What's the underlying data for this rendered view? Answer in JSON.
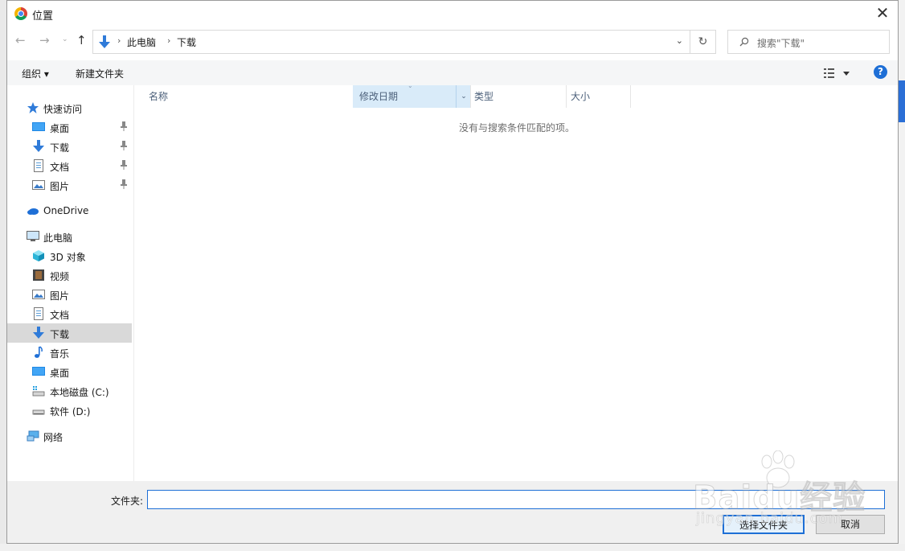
{
  "window": {
    "title": "位置",
    "close_glyph": "✕"
  },
  "navigation": {
    "back_glyph": "←",
    "forward_glyph": "→",
    "recent_glyph": "⌄",
    "up_glyph": "↑",
    "refresh_glyph": "↻",
    "breadcrumb_sep": "›",
    "dropdown_glyph": "⌄",
    "breadcrumbs": [
      "此电脑",
      "下载"
    ]
  },
  "search": {
    "placeholder": "搜索\"下载\""
  },
  "toolbar": {
    "organize_label": "组织 ▾",
    "new_folder_label": "新建文件夹",
    "help_glyph": "?"
  },
  "sidebar": {
    "items": [
      {
        "label": "快速访问",
        "icon": "star-icon"
      },
      {
        "label": "桌面",
        "icon": "desktop-icon",
        "pinned": true
      },
      {
        "label": "下载",
        "icon": "download-icon",
        "pinned": true
      },
      {
        "label": "文档",
        "icon": "document-icon",
        "pinned": true
      },
      {
        "label": "图片",
        "icon": "pictures-icon",
        "pinned": true
      },
      {
        "label": "OneDrive",
        "icon": "cloud-icon"
      },
      {
        "label": "此电脑",
        "icon": "computer-icon"
      },
      {
        "label": "3D 对象",
        "icon": "cube-icon"
      },
      {
        "label": "视频",
        "icon": "video-icon"
      },
      {
        "label": "图片",
        "icon": "pictures-icon"
      },
      {
        "label": "文档",
        "icon": "document-icon"
      },
      {
        "label": "下载",
        "icon": "download-icon",
        "selected": true
      },
      {
        "label": "音乐",
        "icon": "music-icon"
      },
      {
        "label": "桌面",
        "icon": "desktop-icon"
      },
      {
        "label": "本地磁盘 (C:)",
        "icon": "drive-icon"
      },
      {
        "label": "软件 (D:)",
        "icon": "drive-icon"
      },
      {
        "label": "网络",
        "icon": "network-icon"
      }
    ]
  },
  "columns": {
    "name": "名称",
    "date_modified": "修改日期",
    "type": "类型",
    "size": "大小"
  },
  "content": {
    "empty_message": "没有与搜索条件匹配的项。"
  },
  "footer": {
    "folder_label": "文件夹:",
    "folder_value": "",
    "select_button": "选择文件夹",
    "cancel_button": "取消"
  },
  "watermark": {
    "text": "Baidu经验",
    "subtext": "jingyan.baidu.com"
  },
  "colors": {
    "accent": "#1e6fd6",
    "selected_row": "#d9d9d9",
    "sorted_column": "#d9ebf9"
  }
}
